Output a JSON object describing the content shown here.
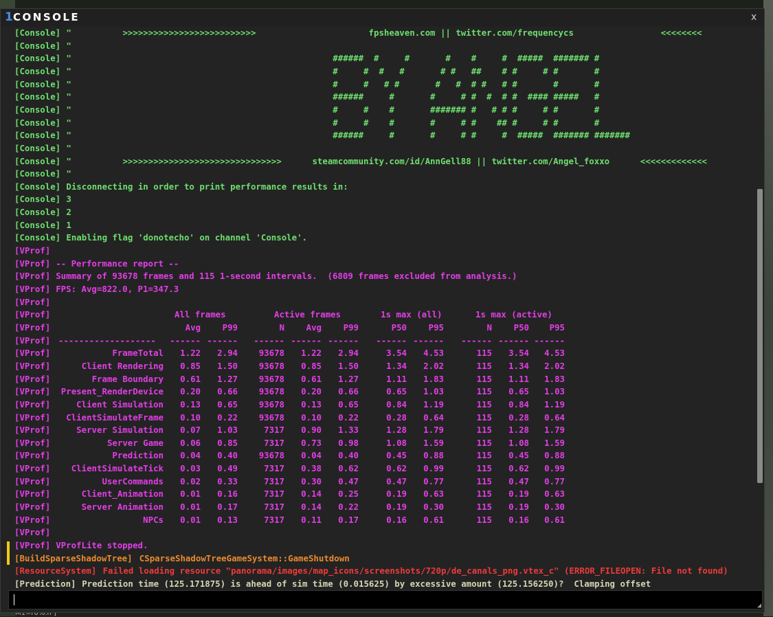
{
  "window": {
    "title": "CONSOLE",
    "logo_glyph": "1",
    "close_label": "x"
  },
  "console_lines": [
    {
      "kind": "console",
      "prefix": "[Console]",
      "text": "\"          >>>>>>>>>>>>>>>>>>>>>>>>>>                      fpsheaven.com || twitter.com/frequencycs                 <<<<<<<<"
    },
    {
      "kind": "console",
      "prefix": "[Console]",
      "text": "\""
    },
    {
      "kind": "console",
      "prefix": "[Console]",
      "text": "\"                                                   ######  #     #       #    #     #  #####  ####### #"
    },
    {
      "kind": "console",
      "prefix": "[Console]",
      "text": "\"                                                   #     #  #   #       # #   ##    # #     # #       #"
    },
    {
      "kind": "console",
      "prefix": "[Console]",
      "text": "\"                                                   #     #   # #       #   #  # #   # #       #       #"
    },
    {
      "kind": "console",
      "prefix": "[Console]",
      "text": "\"                                                   ######     #       #     # #  #  # #  #### #####   #"
    },
    {
      "kind": "console",
      "prefix": "[Console]",
      "text": "\"                                                   #     #    #       ####### #   # # #     # #       #"
    },
    {
      "kind": "console",
      "prefix": "[Console]",
      "text": "\"                                                   #     #    #       #     # #    ## #     # #       #"
    },
    {
      "kind": "console",
      "prefix": "[Console]",
      "text": "\"                                                   ######     #       #     # #     #  #####  ####### #######"
    },
    {
      "kind": "console",
      "prefix": "[Console]",
      "text": "\""
    },
    {
      "kind": "console",
      "prefix": "[Console]",
      "text": "\"          >>>>>>>>>>>>>>>>>>>>>>>>>>>>>>>      steamcommunity.com/id/AnnGell88 || twitter.com/Angel_foxxo      <<<<<<<<<<<<<"
    },
    {
      "kind": "console",
      "prefix": "[Console]",
      "text": "\""
    },
    {
      "kind": "console",
      "prefix": "[Console]",
      "text": "Disconnecting in order to print performance results in:"
    },
    {
      "kind": "console",
      "prefix": "[Console]",
      "text": "3"
    },
    {
      "kind": "console",
      "prefix": "[Console]",
      "text": "2"
    },
    {
      "kind": "console",
      "prefix": "[Console]",
      "text": "1"
    },
    {
      "kind": "console",
      "prefix": "[Console]",
      "text": "Enabling flag 'donotecho' on channel 'Console'."
    },
    {
      "kind": "vprof",
      "prefix": "[VProf]",
      "text": ""
    },
    {
      "kind": "vprof",
      "prefix": "[VProf]",
      "text": "-- Performance report --"
    },
    {
      "kind": "vprof",
      "prefix": "[VProf]",
      "text": "Summary of 93678 frames and 115 1-second intervals.  (6809 frames excluded from analysis.)"
    },
    {
      "kind": "vprof",
      "prefix": "[VProf]",
      "text": "FPS: Avg=822.0, P1=347.3"
    },
    {
      "kind": "vprof",
      "prefix": "[VProf]",
      "text": ""
    }
  ],
  "perf_table": {
    "prefix": "[VProf]",
    "group_headers": [
      "All frames",
      "Active frames",
      "1s max (all)",
      "1s max (active)"
    ],
    "columns": [
      "",
      "Avg",
      "P99",
      "N",
      "Avg",
      "P99",
      "P50",
      "P95",
      "N",
      "P50",
      "P95"
    ],
    "separator": [
      "-------------------",
      "------",
      "------",
      "------",
      "------",
      "------",
      "------",
      "------",
      "------",
      "------",
      "------"
    ],
    "rows": [
      [
        "FrameTotal",
        "1.22",
        "2.94",
        "93678",
        "1.22",
        "2.94",
        "3.54",
        "4.53",
        "115",
        "3.54",
        "4.53"
      ],
      [
        "Client Rendering",
        "0.85",
        "1.50",
        "93678",
        "0.85",
        "1.50",
        "1.34",
        "2.02",
        "115",
        "1.34",
        "2.02"
      ],
      [
        "Frame Boundary",
        "0.61",
        "1.27",
        "93678",
        "0.61",
        "1.27",
        "1.11",
        "1.83",
        "115",
        "1.11",
        "1.83"
      ],
      [
        "Present_RenderDevice",
        "0.20",
        "0.66",
        "93678",
        "0.20",
        "0.66",
        "0.65",
        "1.03",
        "115",
        "0.65",
        "1.03"
      ],
      [
        "Client Simulation",
        "0.13",
        "0.65",
        "93678",
        "0.13",
        "0.65",
        "0.84",
        "1.19",
        "115",
        "0.84",
        "1.19"
      ],
      [
        "ClientSimulateFrame",
        "0.10",
        "0.22",
        "93678",
        "0.10",
        "0.22",
        "0.28",
        "0.64",
        "115",
        "0.28",
        "0.64"
      ],
      [
        "Server Simulation",
        "0.07",
        "1.03",
        "7317",
        "0.90",
        "1.33",
        "1.28",
        "1.79",
        "115",
        "1.28",
        "1.79"
      ],
      [
        "Server Game",
        "0.06",
        "0.85",
        "7317",
        "0.73",
        "0.98",
        "1.08",
        "1.59",
        "115",
        "1.08",
        "1.59"
      ],
      [
        "Prediction",
        "0.04",
        "0.40",
        "93678",
        "0.04",
        "0.40",
        "0.45",
        "0.88",
        "115",
        "0.45",
        "0.88"
      ],
      [
        "ClientSimulateTick",
        "0.03",
        "0.49",
        "7317",
        "0.38",
        "0.62",
        "0.62",
        "0.99",
        "115",
        "0.62",
        "0.99"
      ],
      [
        "UserCommands",
        "0.02",
        "0.33",
        "7317",
        "0.30",
        "0.47",
        "0.47",
        "0.77",
        "115",
        "0.47",
        "0.77"
      ],
      [
        "Client_Animation",
        "0.01",
        "0.16",
        "7317",
        "0.14",
        "0.25",
        "0.19",
        "0.63",
        "115",
        "0.19",
        "0.63"
      ],
      [
        "Server Animation",
        "0.01",
        "0.17",
        "7317",
        "0.14",
        "0.22",
        "0.19",
        "0.30",
        "115",
        "0.19",
        "0.30"
      ],
      [
        "NPCs",
        "0.01",
        "0.13",
        "7317",
        "0.11",
        "0.17",
        "0.16",
        "0.61",
        "115",
        "0.16",
        "0.61"
      ]
    ]
  },
  "tail_lines": [
    {
      "kind": "vprof",
      "prefix": "[VProf]",
      "text": ""
    },
    {
      "kind": "vprof",
      "prefix": "[VProf]",
      "text": "VProfLite stopped."
    },
    {
      "kind": "build",
      "prefix": "[BuildSparseShadowTree]",
      "text": "CSparseShadowTreeGameSystem::GameShutdown"
    },
    {
      "kind": "res",
      "prefix": "[ResourceSystem]",
      "text": "Failed loading resource \"panorama/images/map_icons/screenshots/720p/de_canals_png.vtex_c\" (ERROR_FILEOPEN: File not found)"
    },
    {
      "kind": "pred",
      "prefix": "[Prediction]",
      "text": "Prediction time (125.171875) is ahead of sim time (0.015625) by excessive amount (125.156250)?  Clamping offset"
    }
  ],
  "command_input": {
    "value": "",
    "placeholder": ""
  },
  "background_text": "M1=r0%.n ]"
}
